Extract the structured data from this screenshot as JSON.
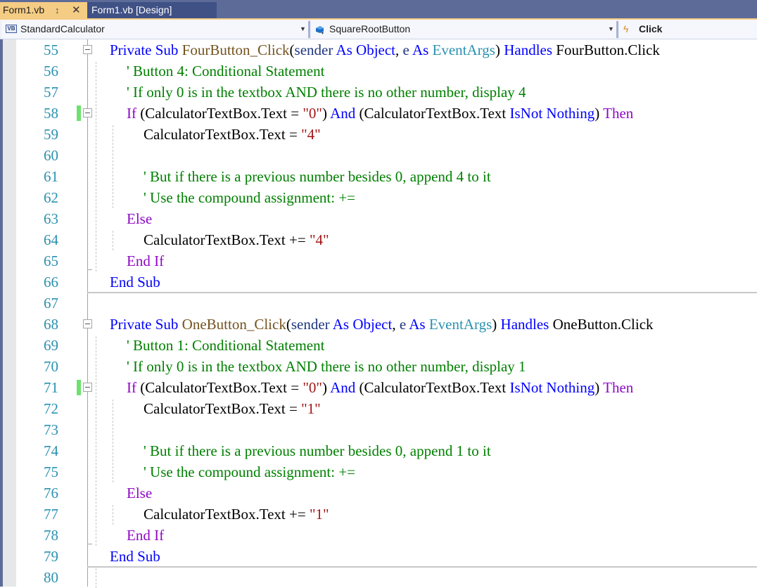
{
  "tabs": [
    {
      "label": "Form1.vb",
      "active": true,
      "pin_icon": "pin-icon",
      "close_icon": "close-icon"
    },
    {
      "label": "Form1.vb [Design]",
      "active": false
    }
  ],
  "navbar": {
    "project": {
      "label": "StandardCalculator",
      "icon": "vb-project-icon"
    },
    "object": {
      "label": "SquareRootButton",
      "icon": "control-object-icon"
    },
    "member": {
      "label": "Click",
      "icon": "event-bolt-icon"
    }
  },
  "colors": {
    "keyword": "#0000ff",
    "control_keyword": "#8f08c4",
    "method": "#74531f",
    "type": "#2b91af",
    "parameter": "#1f377f",
    "string": "#a31515",
    "comment": "#008000",
    "line_number": "#2b91af",
    "change_marker": "#6ce26c",
    "active_tab": "#f5cc84",
    "tabbar": "#5d6b99"
  },
  "editor": {
    "lines": [
      {
        "num": "55",
        "indent": 0,
        "fold": true,
        "change": false,
        "tokens": [
          {
            "t": "Private Sub ",
            "c": "kw"
          },
          {
            "t": "FourButton_Click",
            "c": "mth"
          },
          {
            "t": "(",
            "c": ""
          },
          {
            "t": "sender",
            "c": "par"
          },
          {
            "t": " ",
            "c": ""
          },
          {
            "t": "As Object",
            "c": "kw"
          },
          {
            "t": ", ",
            "c": ""
          },
          {
            "t": "e",
            "c": "par"
          },
          {
            "t": " ",
            "c": ""
          },
          {
            "t": "As",
            "c": "kw"
          },
          {
            "t": " ",
            "c": ""
          },
          {
            "t": "EventArgs",
            "c": "typ"
          },
          {
            "t": ") ",
            "c": ""
          },
          {
            "t": "Handles",
            "c": "kw"
          },
          {
            "t": " FourButton.Click",
            "c": ""
          }
        ]
      },
      {
        "num": "56",
        "indent": 1,
        "tokens": [
          {
            "t": "' Button 4: Conditional Statement",
            "c": "cmt"
          }
        ]
      },
      {
        "num": "57",
        "indent": 1,
        "tokens": [
          {
            "t": "' If only 0 is in the textbox AND there is no other number, display 4",
            "c": "cmt"
          }
        ]
      },
      {
        "num": "58",
        "indent": 1,
        "fold": true,
        "change": true,
        "tokens": [
          {
            "t": "If",
            "c": "ctl"
          },
          {
            "t": " (CalculatorTextBox.Text = ",
            "c": ""
          },
          {
            "t": "\"0\"",
            "c": "str"
          },
          {
            "t": ") ",
            "c": ""
          },
          {
            "t": "And",
            "c": "kw"
          },
          {
            "t": " (CalculatorTextBox.Text ",
            "c": ""
          },
          {
            "t": "IsNot Nothing",
            "c": "kw"
          },
          {
            "t": ") ",
            "c": ""
          },
          {
            "t": "Then",
            "c": "ctl"
          }
        ]
      },
      {
        "num": "59",
        "indent": 2,
        "tokens": [
          {
            "t": "CalculatorTextBox.Text = ",
            "c": ""
          },
          {
            "t": "\"4\"",
            "c": "str"
          }
        ]
      },
      {
        "num": "60",
        "indent": 2,
        "tokens": []
      },
      {
        "num": "61",
        "indent": 2,
        "tokens": [
          {
            "t": "' But if there is a previous number besides 0, append 4 to it",
            "c": "cmt"
          }
        ]
      },
      {
        "num": "62",
        "indent": 2,
        "tokens": [
          {
            "t": "' Use the compound assignment: +=",
            "c": "cmt"
          }
        ]
      },
      {
        "num": "63",
        "indent": 1,
        "tokens": [
          {
            "t": "Else",
            "c": "ctl"
          }
        ]
      },
      {
        "num": "64",
        "indent": 2,
        "tokens": [
          {
            "t": "CalculatorTextBox.Text += ",
            "c": ""
          },
          {
            "t": "\"4\"",
            "c": "str"
          }
        ]
      },
      {
        "num": "65",
        "indent": 1,
        "endtick": true,
        "tokens": [
          {
            "t": "End If",
            "c": "ctl"
          }
        ]
      },
      {
        "num": "66",
        "indent": 0,
        "tokens": [
          {
            "t": "End Sub",
            "c": "kw"
          }
        ]
      },
      {
        "num": "67",
        "indent": 0,
        "tokens": []
      },
      {
        "num": "68",
        "indent": 0,
        "fold": true,
        "tokens": [
          {
            "t": "Private Sub ",
            "c": "kw"
          },
          {
            "t": "OneButton_Click",
            "c": "mth"
          },
          {
            "t": "(",
            "c": ""
          },
          {
            "t": "sender",
            "c": "par"
          },
          {
            "t": " ",
            "c": ""
          },
          {
            "t": "As Object",
            "c": "kw"
          },
          {
            "t": ", ",
            "c": ""
          },
          {
            "t": "e",
            "c": "par"
          },
          {
            "t": " ",
            "c": ""
          },
          {
            "t": "As",
            "c": "kw"
          },
          {
            "t": " ",
            "c": ""
          },
          {
            "t": "EventArgs",
            "c": "typ"
          },
          {
            "t": ") ",
            "c": ""
          },
          {
            "t": "Handles",
            "c": "kw"
          },
          {
            "t": " OneButton.Click",
            "c": ""
          }
        ]
      },
      {
        "num": "69",
        "indent": 1,
        "tokens": [
          {
            "t": "' Button 1: Conditional Statement",
            "c": "cmt"
          }
        ]
      },
      {
        "num": "70",
        "indent": 1,
        "tokens": [
          {
            "t": "' If only 0 is in the textbox AND there is no other number, display 1",
            "c": "cmt"
          }
        ]
      },
      {
        "num": "71",
        "indent": 1,
        "fold": true,
        "change": true,
        "tokens": [
          {
            "t": "If",
            "c": "ctl"
          },
          {
            "t": " (CalculatorTextBox.Text = ",
            "c": ""
          },
          {
            "t": "\"0\"",
            "c": "str"
          },
          {
            "t": ") ",
            "c": ""
          },
          {
            "t": "And",
            "c": "kw"
          },
          {
            "t": " (CalculatorTextBox.Text ",
            "c": ""
          },
          {
            "t": "IsNot Nothing",
            "c": "kw"
          },
          {
            "t": ") ",
            "c": ""
          },
          {
            "t": "Then",
            "c": "ctl"
          }
        ]
      },
      {
        "num": "72",
        "indent": 2,
        "tokens": [
          {
            "t": "CalculatorTextBox.Text = ",
            "c": ""
          },
          {
            "t": "\"1\"",
            "c": "str"
          }
        ]
      },
      {
        "num": "73",
        "indent": 2,
        "tokens": []
      },
      {
        "num": "74",
        "indent": 2,
        "tokens": [
          {
            "t": "' But if there is a previous number besides 0, append 1 to it",
            "c": "cmt"
          }
        ]
      },
      {
        "num": "75",
        "indent": 2,
        "tokens": [
          {
            "t": "' Use the compound assignment: +=",
            "c": "cmt"
          }
        ]
      },
      {
        "num": "76",
        "indent": 1,
        "tokens": [
          {
            "t": "Else",
            "c": "ctl"
          }
        ]
      },
      {
        "num": "77",
        "indent": 2,
        "tokens": [
          {
            "t": "CalculatorTextBox.Text += ",
            "c": ""
          },
          {
            "t": "\"1\"",
            "c": "str"
          }
        ]
      },
      {
        "num": "78",
        "indent": 1,
        "endtick": true,
        "tokens": [
          {
            "t": "End If",
            "c": "ctl"
          }
        ]
      },
      {
        "num": "79",
        "indent": 0,
        "tokens": [
          {
            "t": "End Sub",
            "c": "kw"
          }
        ]
      },
      {
        "num": "80",
        "indent": 0,
        "tokens": []
      }
    ]
  }
}
